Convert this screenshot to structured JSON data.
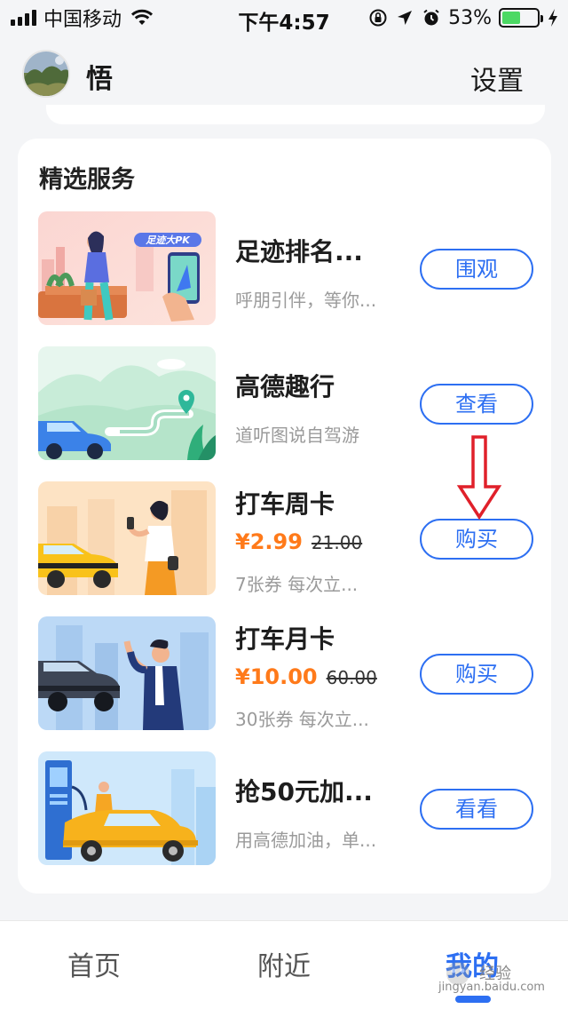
{
  "status_bar": {
    "carrier": "中国移动",
    "time": "下午4:57",
    "battery_percent": "53%",
    "battery_level": 0.53,
    "icons": [
      "signal-icon",
      "wifi-icon",
      "orientation-lock-icon",
      "location-icon",
      "alarm-icon",
      "battery-icon",
      "charging-icon"
    ]
  },
  "header": {
    "username": "悟",
    "settings_label": "设置"
  },
  "section": {
    "title": "精选服务",
    "items": [
      {
        "title": "足迹排名...",
        "subtitle": "呼朋引伴，等你...",
        "button": "围观",
        "thumb_badge": "足迹大PK"
      },
      {
        "title": "高德趣行",
        "subtitle": "道听图说自驾游",
        "button": "查看"
      },
      {
        "title": "打车周卡",
        "price": "¥2.99",
        "original_price": "21.00",
        "subtitle": "7张券 每次立...",
        "button": "购买"
      },
      {
        "title": "打车月卡",
        "price": "¥10.00",
        "original_price": "60.00",
        "subtitle": "30张券 每次立...",
        "button": "购买"
      },
      {
        "title": "抢50元加...",
        "subtitle": "用高德加油，单...",
        "button": "看看"
      }
    ]
  },
  "tabbar": {
    "home": "首页",
    "nearby": "附近",
    "mine": "我的"
  },
  "watermark": {
    "text": "经验",
    "url": "jingyan.baidu.com"
  },
  "colors": {
    "accent": "#2d6ff2",
    "price": "#ff7a1a",
    "annotation": "#e0202a",
    "background": "#f4f5f7"
  }
}
